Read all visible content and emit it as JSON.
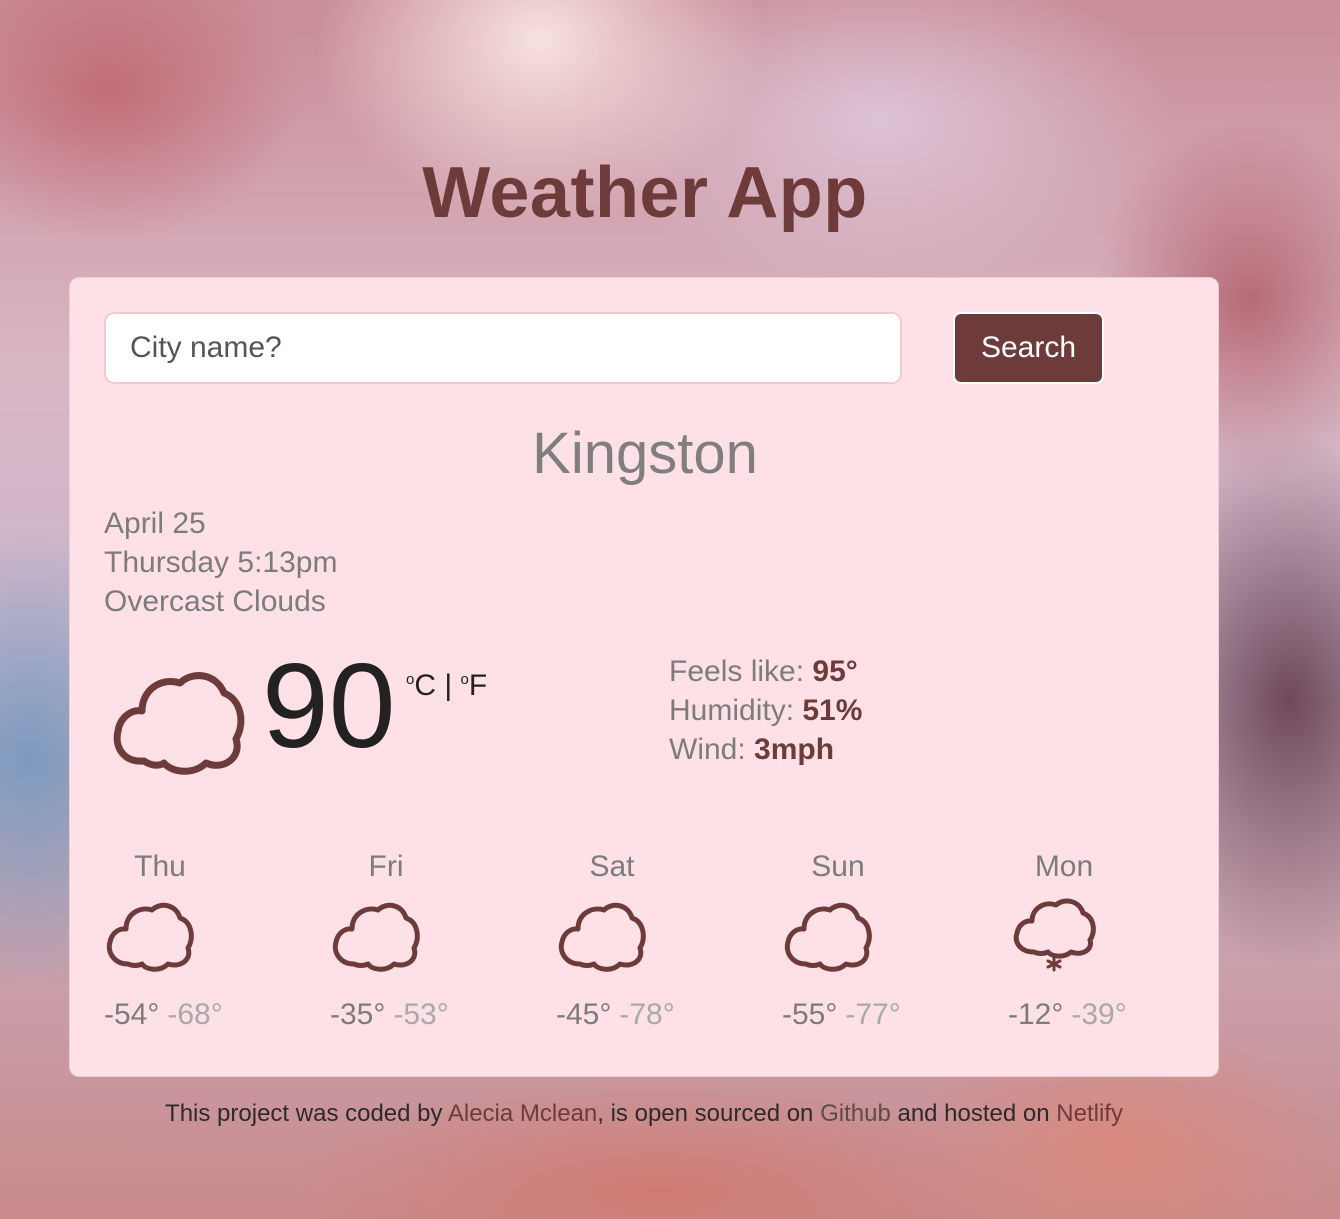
{
  "app": {
    "title": "Weather App"
  },
  "search": {
    "placeholder": "City name?",
    "button_label": "Search"
  },
  "current": {
    "city": "Kingston",
    "date": "April 25",
    "day_time": "Thursday 5:13pm",
    "description": "Overcast Clouds",
    "temperature": "90",
    "unit_celsius": "C",
    "unit_separator": " | ",
    "unit_fahrenheit": "F",
    "icon": "cloud-icon"
  },
  "details": {
    "feels_like_label": "Feels like: ",
    "feels_like_value": "95°",
    "humidity_label": "Humidity: ",
    "humidity_value": "51%",
    "wind_label": "Wind: ",
    "wind_value": "3mph"
  },
  "forecast": [
    {
      "day": "Thu",
      "high": "-54°",
      "low": "-68°",
      "icon": "cloud-icon"
    },
    {
      "day": "Fri",
      "high": "-35°",
      "low": "-53°",
      "icon": "cloud-icon"
    },
    {
      "day": "Sat",
      "high": "-45°",
      "low": "-78°",
      "icon": "cloud-icon"
    },
    {
      "day": "Sun",
      "high": "-55°",
      "low": "-77°",
      "icon": "cloud-icon"
    },
    {
      "day": "Mon",
      "high": "-12°",
      "low": "-39°",
      "icon": "snow-cloud-icon"
    }
  ],
  "footer": {
    "text1": "This project was coded by ",
    "link1": "Alecia Mclean",
    "text2": ", is open sourced on ",
    "link2": "Github",
    "text3": " and hosted on ",
    "link3": "Netlify"
  },
  "colors": {
    "accent": "#6e3b3b",
    "card_bg": "#fde1e6"
  }
}
